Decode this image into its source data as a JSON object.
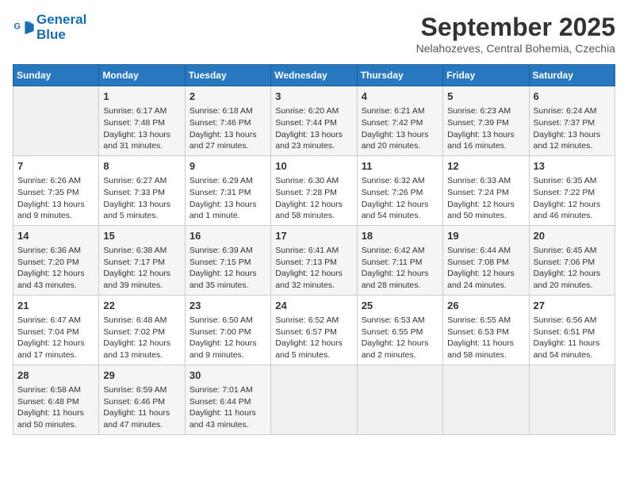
{
  "header": {
    "logo_line1": "General",
    "logo_line2": "Blue",
    "month": "September 2025",
    "location": "Nelahozeves, Central Bohemia, Czechia"
  },
  "days_of_week": [
    "Sunday",
    "Monday",
    "Tuesday",
    "Wednesday",
    "Thursday",
    "Friday",
    "Saturday"
  ],
  "weeks": [
    [
      {
        "day": "",
        "info": ""
      },
      {
        "day": "1",
        "info": "Sunrise: 6:17 AM\nSunset: 7:48 PM\nDaylight: 13 hours\nand 31 minutes."
      },
      {
        "day": "2",
        "info": "Sunrise: 6:18 AM\nSunset: 7:46 PM\nDaylight: 13 hours\nand 27 minutes."
      },
      {
        "day": "3",
        "info": "Sunrise: 6:20 AM\nSunset: 7:44 PM\nDaylight: 13 hours\nand 23 minutes."
      },
      {
        "day": "4",
        "info": "Sunrise: 6:21 AM\nSunset: 7:42 PM\nDaylight: 13 hours\nand 20 minutes."
      },
      {
        "day": "5",
        "info": "Sunrise: 6:23 AM\nSunset: 7:39 PM\nDaylight: 13 hours\nand 16 minutes."
      },
      {
        "day": "6",
        "info": "Sunrise: 6:24 AM\nSunset: 7:37 PM\nDaylight: 13 hours\nand 12 minutes."
      }
    ],
    [
      {
        "day": "7",
        "info": "Sunrise: 6:26 AM\nSunset: 7:35 PM\nDaylight: 13 hours\nand 9 minutes."
      },
      {
        "day": "8",
        "info": "Sunrise: 6:27 AM\nSunset: 7:33 PM\nDaylight: 13 hours\nand 5 minutes."
      },
      {
        "day": "9",
        "info": "Sunrise: 6:29 AM\nSunset: 7:31 PM\nDaylight: 13 hours\nand 1 minute."
      },
      {
        "day": "10",
        "info": "Sunrise: 6:30 AM\nSunset: 7:28 PM\nDaylight: 12 hours\nand 58 minutes."
      },
      {
        "day": "11",
        "info": "Sunrise: 6:32 AM\nSunset: 7:26 PM\nDaylight: 12 hours\nand 54 minutes."
      },
      {
        "day": "12",
        "info": "Sunrise: 6:33 AM\nSunset: 7:24 PM\nDaylight: 12 hours\nand 50 minutes."
      },
      {
        "day": "13",
        "info": "Sunrise: 6:35 AM\nSunset: 7:22 PM\nDaylight: 12 hours\nand 46 minutes."
      }
    ],
    [
      {
        "day": "14",
        "info": "Sunrise: 6:36 AM\nSunset: 7:20 PM\nDaylight: 12 hours\nand 43 minutes."
      },
      {
        "day": "15",
        "info": "Sunrise: 6:38 AM\nSunset: 7:17 PM\nDaylight: 12 hours\nand 39 minutes."
      },
      {
        "day": "16",
        "info": "Sunrise: 6:39 AM\nSunset: 7:15 PM\nDaylight: 12 hours\nand 35 minutes."
      },
      {
        "day": "17",
        "info": "Sunrise: 6:41 AM\nSunset: 7:13 PM\nDaylight: 12 hours\nand 32 minutes."
      },
      {
        "day": "18",
        "info": "Sunrise: 6:42 AM\nSunset: 7:11 PM\nDaylight: 12 hours\nand 28 minutes."
      },
      {
        "day": "19",
        "info": "Sunrise: 6:44 AM\nSunset: 7:08 PM\nDaylight: 12 hours\nand 24 minutes."
      },
      {
        "day": "20",
        "info": "Sunrise: 6:45 AM\nSunset: 7:06 PM\nDaylight: 12 hours\nand 20 minutes."
      }
    ],
    [
      {
        "day": "21",
        "info": "Sunrise: 6:47 AM\nSunset: 7:04 PM\nDaylight: 12 hours\nand 17 minutes."
      },
      {
        "day": "22",
        "info": "Sunrise: 6:48 AM\nSunset: 7:02 PM\nDaylight: 12 hours\nand 13 minutes."
      },
      {
        "day": "23",
        "info": "Sunrise: 6:50 AM\nSunset: 7:00 PM\nDaylight: 12 hours\nand 9 minutes."
      },
      {
        "day": "24",
        "info": "Sunrise: 6:52 AM\nSunset: 6:57 PM\nDaylight: 12 hours\nand 5 minutes."
      },
      {
        "day": "25",
        "info": "Sunrise: 6:53 AM\nSunset: 6:55 PM\nDaylight: 12 hours\nand 2 minutes."
      },
      {
        "day": "26",
        "info": "Sunrise: 6:55 AM\nSunset: 6:53 PM\nDaylight: 11 hours\nand 58 minutes."
      },
      {
        "day": "27",
        "info": "Sunrise: 6:56 AM\nSunset: 6:51 PM\nDaylight: 11 hours\nand 54 minutes."
      }
    ],
    [
      {
        "day": "28",
        "info": "Sunrise: 6:58 AM\nSunset: 6:48 PM\nDaylight: 11 hours\nand 50 minutes."
      },
      {
        "day": "29",
        "info": "Sunrise: 6:59 AM\nSunset: 6:46 PM\nDaylight: 11 hours\nand 47 minutes."
      },
      {
        "day": "30",
        "info": "Sunrise: 7:01 AM\nSunset: 6:44 PM\nDaylight: 11 hours\nand 43 minutes."
      },
      {
        "day": "",
        "info": ""
      },
      {
        "day": "",
        "info": ""
      },
      {
        "day": "",
        "info": ""
      },
      {
        "day": "",
        "info": ""
      }
    ]
  ]
}
